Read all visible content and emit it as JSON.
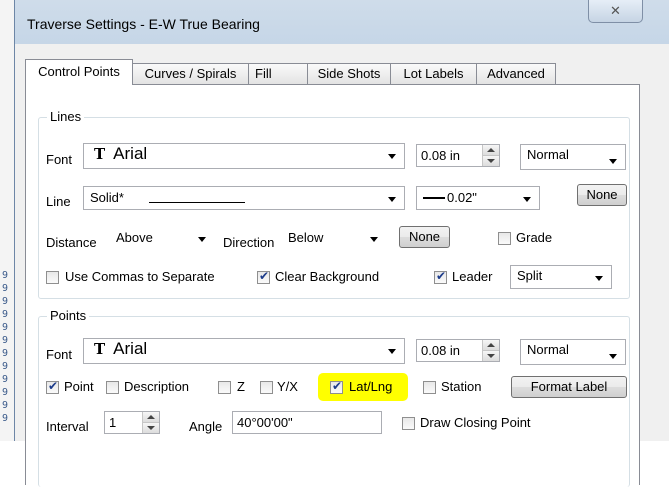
{
  "window": {
    "title": "Traverse Settings - E-W True Bearing"
  },
  "tabs": [
    "Control Points",
    "Curves / Spirals",
    "Fill",
    "Side Shots",
    "Lot Labels",
    "Advanced"
  ],
  "lines": {
    "group_label": "Lines",
    "font_label": "Font",
    "font_value": "Arial",
    "font_size": "0.08 in",
    "font_style": "Normal",
    "line_label": "Line",
    "line_type": "Solid*",
    "line_weight": "0.02\"",
    "none_button": "None",
    "distance_label": "Distance",
    "distance_value": "Above",
    "direction_label": "Direction",
    "direction_value": "Below",
    "none_button_2": "None",
    "grade_label": "Grade",
    "use_commas_label": "Use Commas to Separate",
    "clear_background_label": "Clear Background",
    "leader_label": "Leader",
    "leader_value": "Split"
  },
  "points": {
    "group_label": "Points",
    "font_label": "Font",
    "font_value": "Arial",
    "font_size": "0.08 in",
    "font_style": "Normal",
    "point_label": "Point",
    "description_label": "Description",
    "z_label": "Z",
    "yx_label": "Y/X",
    "latlng_label": "Lat/Lng",
    "station_label": "Station",
    "format_label_button": "Format Label",
    "interval_label": "Interval",
    "interval_value": "1",
    "angle_label": "Angle",
    "angle_value": "40°00'00\"",
    "draw_closing_label": "Draw Closing Point"
  },
  "checkbox_states": {
    "grade": false,
    "use_commas": false,
    "clear_background": true,
    "leader": true,
    "point": true,
    "description": false,
    "z": false,
    "yx": false,
    "latlng": true,
    "station": false,
    "draw_closing": false
  },
  "colors": {
    "highlight": "#ffff00",
    "titlebar": "#c9d8e8"
  }
}
